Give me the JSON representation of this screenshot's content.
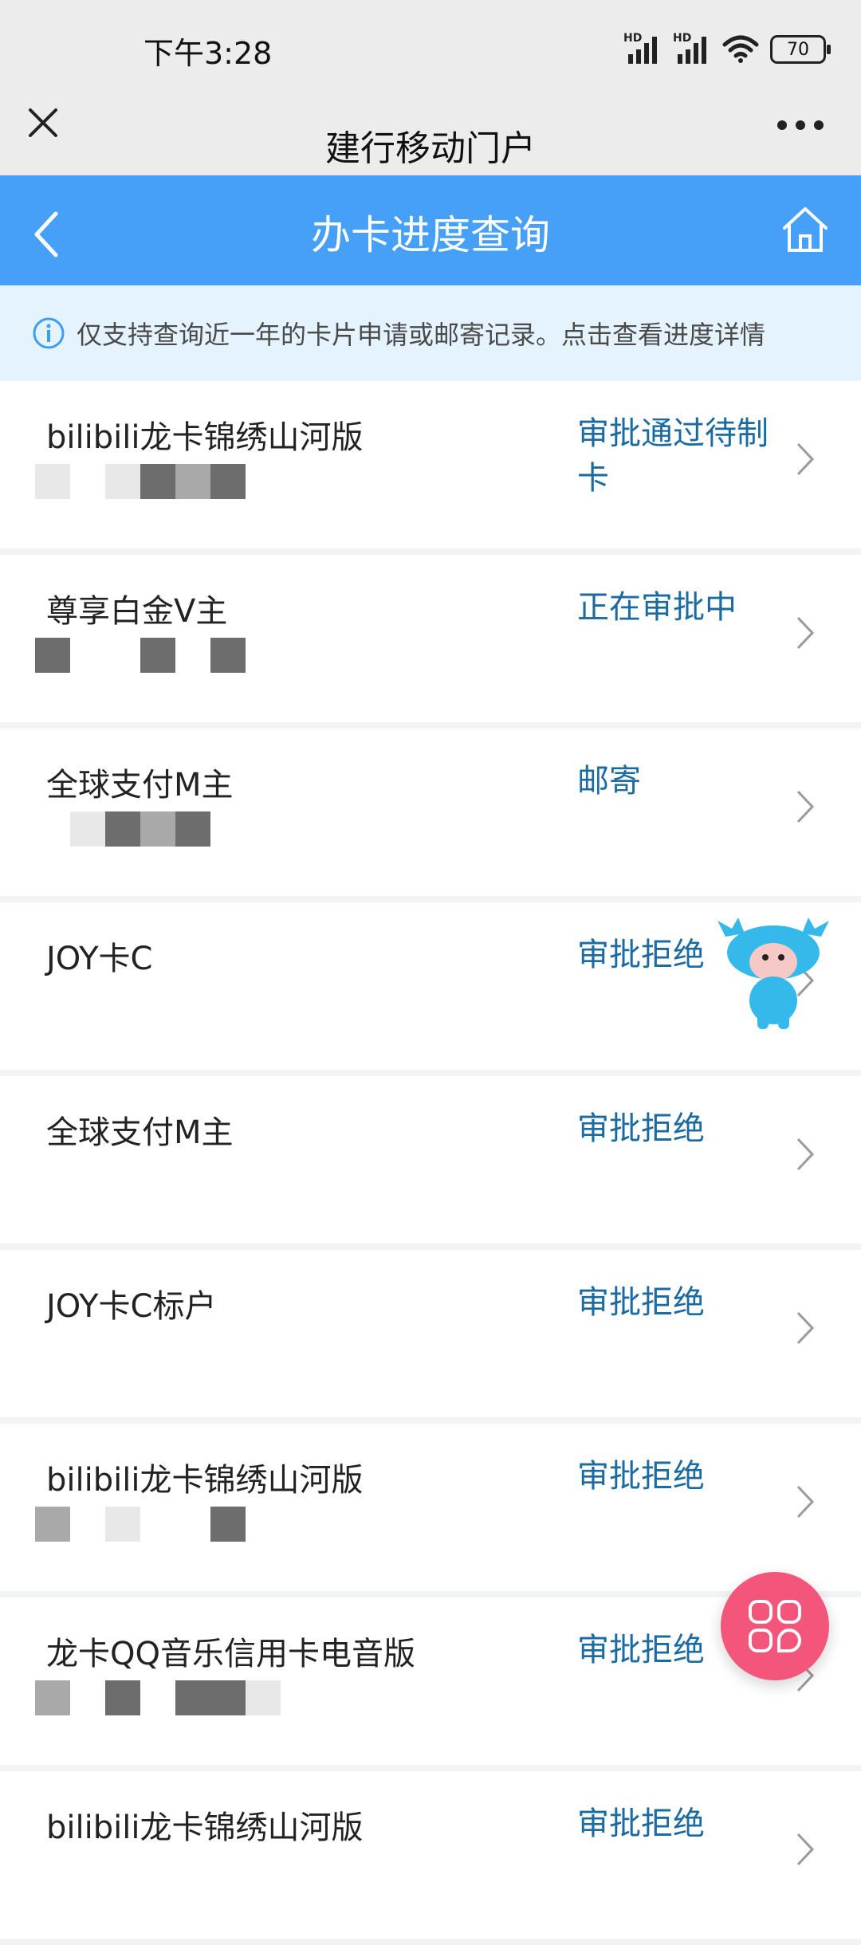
{
  "status_bar": {
    "time": "下午3:28",
    "signal_1": "HD",
    "signal_2": "HD",
    "battery": "70"
  },
  "titlebar": {
    "title": "建行移动门户",
    "close_icon": "close-icon",
    "more_icon": "more-icon"
  },
  "nav": {
    "title": "办卡进度查询",
    "back_icon": "back-icon",
    "home_icon": "home-icon",
    "color": "#46a0f7"
  },
  "notice": {
    "text": "仅支持查询近一年的卡片申请或邮寄记录。点击查看进度详情",
    "icon": "info-icon"
  },
  "applications": [
    {
      "name": "bilibili龙卡锦绣山河版",
      "status": "审批通过待制卡"
    },
    {
      "name": "尊享白金V主",
      "status": "正在审批中"
    },
    {
      "name": "全球支付M主",
      "status": "邮寄"
    },
    {
      "name": "JOY卡C",
      "status": "审批拒绝"
    },
    {
      "name": "全球支付M主",
      "status": "审批拒绝"
    },
    {
      "name": "JOY卡C标户",
      "status": "审批拒绝"
    },
    {
      "name": "bilibili龙卡锦绣山河版",
      "status": "审批拒绝"
    },
    {
      "name": "龙卡QQ音乐信用卡电音版",
      "status": "审批拒绝"
    },
    {
      "name": "bilibili龙卡锦绣山河版",
      "status": "审批拒绝"
    }
  ],
  "colors": {
    "status_text": "#1b6aa0",
    "fab": "#f4557a",
    "notice_bg": "#e4f3fd"
  },
  "floating": {
    "mascot_icon": "mascot-icon",
    "menu_icon": "grid-menu-icon"
  }
}
